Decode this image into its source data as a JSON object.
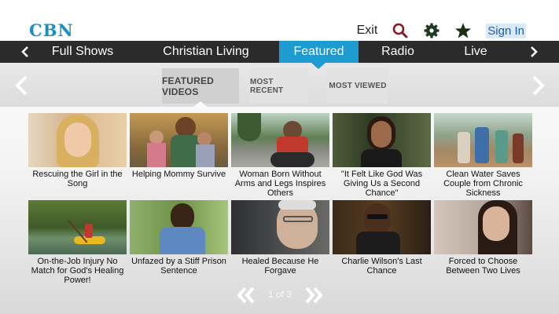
{
  "header": {
    "logo": "CBN",
    "exit_label": "Exit",
    "signin_label": "Sign In",
    "icons": [
      "search-icon",
      "gear-icon",
      "star-icon"
    ]
  },
  "nav": {
    "items": [
      {
        "label": "Full Shows"
      },
      {
        "label": "Christian Living"
      },
      {
        "label": "Featured",
        "active": true
      },
      {
        "label": "Radio"
      },
      {
        "label": "Live"
      }
    ]
  },
  "subtabs": [
    {
      "label": "FEATURED VIDEOS",
      "active": true
    },
    {
      "label": "MOST RECENT"
    },
    {
      "label": "MOST VIEWED"
    }
  ],
  "videos": [
    {
      "title": "Rescuing the Girl in the Song"
    },
    {
      "title": "Helping Mommy Survive"
    },
    {
      "title": "Woman Born Without Arms and Legs Inspires Others"
    },
    {
      "title": "\"It Felt Like God Was Giving Us a Second Chance\""
    },
    {
      "title": "Clean Water Saves Couple from Chronic Sickness"
    },
    {
      "title": "On-the-Job Injury No Match for God's Healing Power!"
    },
    {
      "title": "Unfazed by a Stiff Prison Sentence"
    },
    {
      "title": "Healed Because He Forgave"
    },
    {
      "title": "Charlie Wilson's Last Chance"
    },
    {
      "title": "Forced to Choose Between Two Lives"
    }
  ],
  "pager": {
    "text": "1 of 3"
  },
  "colors": {
    "accent": "#1d9bd1",
    "navbar": "#2b2b2b",
    "logo": "#1a8fc3",
    "signin": "#1b5fa8"
  }
}
